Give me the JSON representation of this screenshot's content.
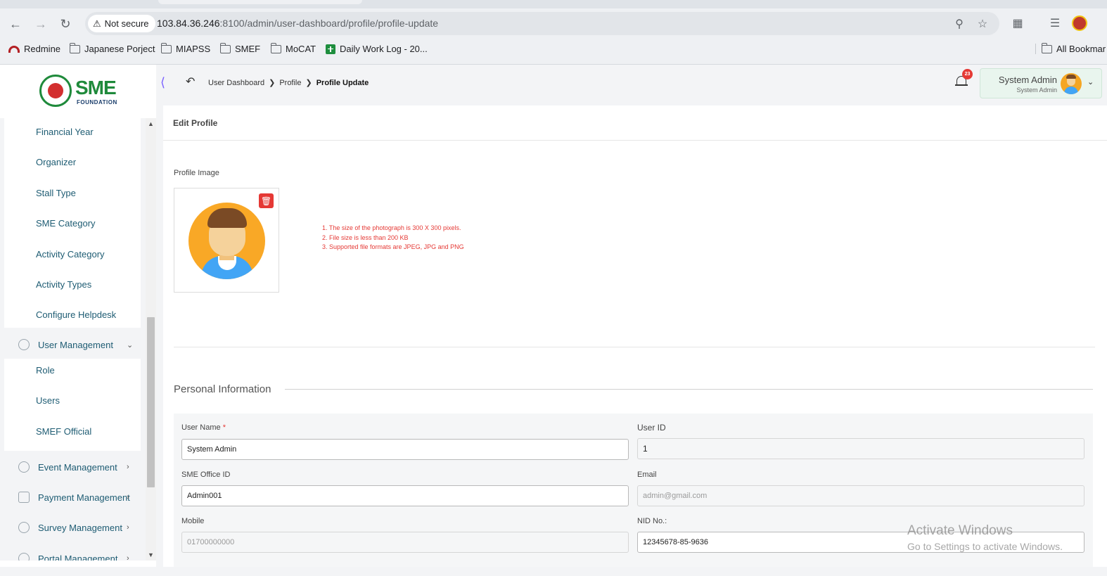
{
  "browser": {
    "security_label": "Not secure",
    "url_host": "103.84.36.246",
    "url_rest": ":8100/admin/user-dashboard/profile/profile-update",
    "bookmarks": [
      "Redmine",
      "Japanese Porject",
      "MIAPSS",
      "SMEF",
      "MoCAT",
      "Daily Work Log - 20...",
      "All Bookmar"
    ]
  },
  "logo": {
    "mark": "SME",
    "sub": "FOUNDATION"
  },
  "sidebar": {
    "settings_items": [
      "Financial Year",
      "Organizer",
      "Stall Type",
      "SME Category",
      "Activity Category",
      "Activity Types",
      "Configure Helpdesk"
    ],
    "user_management": {
      "label": "User Management",
      "items": [
        "Role",
        "Users",
        "SMEF Official"
      ]
    },
    "parents": [
      "Event Management",
      "Payment Management",
      "Survey Management",
      "Portal Management"
    ]
  },
  "topbar": {
    "breadcrumb": [
      "User Dashboard",
      "Profile",
      "Profile Update"
    ],
    "notification_count": "23",
    "user_name": "System Admin",
    "user_role": "System Admin"
  },
  "card": {
    "title": "Edit Profile",
    "profile_image_label": "Profile Image",
    "rules": [
      "1. The size of the photograph is 300 X 300 pixels.",
      "2. File size is less than 200 KB",
      "3. Supported file formats are JPEG, JPG and PNG"
    ],
    "section_title": "Personal Information"
  },
  "form": {
    "user_name": {
      "label": "User Name",
      "required": "*",
      "value": "System Admin"
    },
    "user_id": {
      "label": "User ID",
      "value": "1"
    },
    "sme_office_id": {
      "label": "SME Office ID",
      "value": "Admin001"
    },
    "email": {
      "label": "Email",
      "value": "admin@gmail.com"
    },
    "mobile": {
      "label": "Mobile",
      "value": "01700000000"
    },
    "nid": {
      "label": "NID No.:",
      "value": "12345678-85-9636"
    }
  },
  "watermark": {
    "line1": "Activate Windows",
    "line2": "Go to Settings to activate Windows."
  },
  "icons": [
    "back-arrow-icon",
    "forward-arrow-icon",
    "reload-icon",
    "warning-icon",
    "zoom-icon",
    "star-icon",
    "extensions-icon",
    "media-icon",
    "folder-icon",
    "sheets-icon",
    "bell-icon",
    "trash-icon",
    "chevron-down-icon",
    "chevron-right-icon",
    "undo-icon"
  ]
}
